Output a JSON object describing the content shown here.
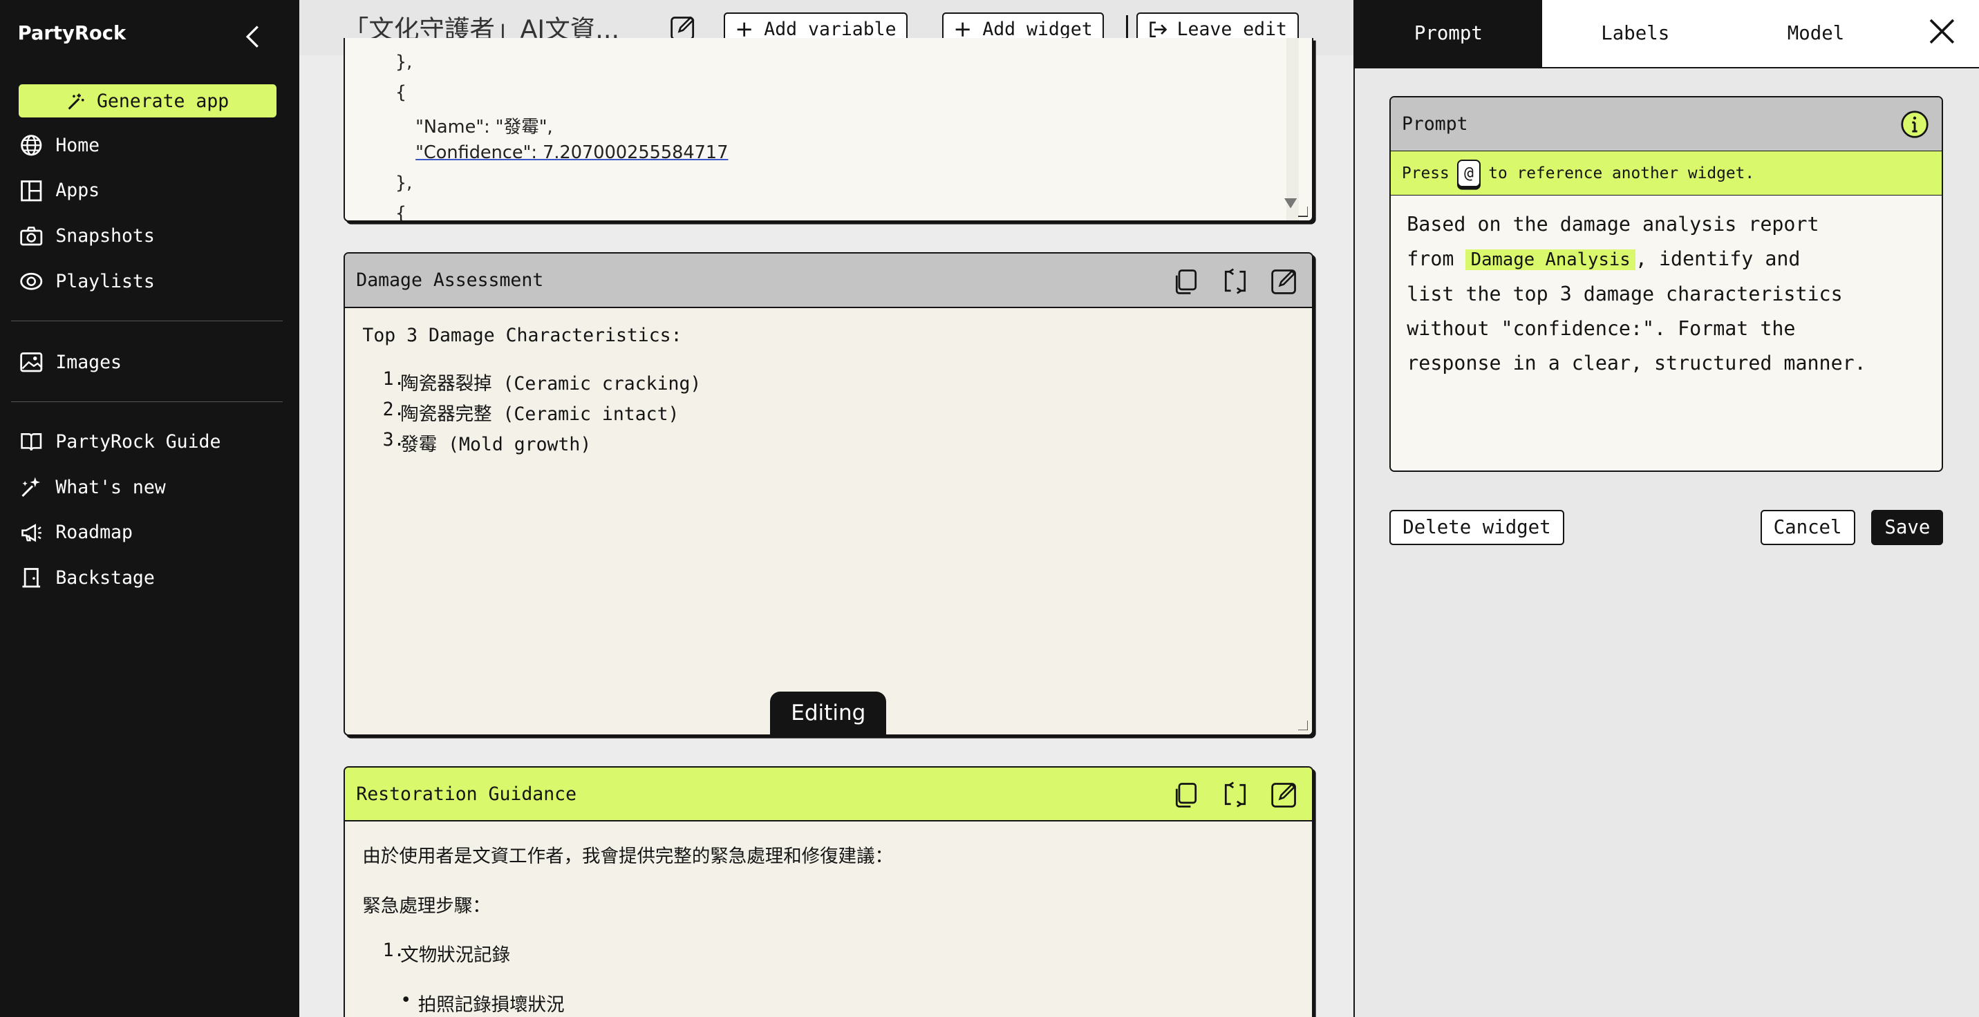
{
  "sidebar": {
    "brand": "PartyRock",
    "generate_label": "Generate app",
    "items": [
      {
        "label": "Home",
        "icon": "globe-icon"
      },
      {
        "label": "Apps",
        "icon": "apps-grid-icon"
      },
      {
        "label": "Snapshots",
        "icon": "camera-icon"
      },
      {
        "label": "Playlists",
        "icon": "playlist-icon"
      },
      {
        "label": "Images",
        "icon": "images-icon"
      },
      {
        "label": "PartyRock Guide",
        "icon": "book-icon"
      },
      {
        "label": "What's new",
        "icon": "sparkles-icon"
      },
      {
        "label": "Roadmap",
        "icon": "megaphone-icon"
      },
      {
        "label": "Backstage",
        "icon": "door-icon"
      }
    ]
  },
  "toolbar": {
    "app_title": "「文化守護者」AI文資...",
    "add_variable": "Add variable",
    "add_widget": "Add widget",
    "leave_edit": "Leave edit"
  },
  "damage_analysis": {
    "lines": [
      "},",
      "{",
      "\"Name\": \"發霉\",",
      "\"Confidence\": 7.207000255584717",
      "},",
      "{"
    ]
  },
  "damage_assessment": {
    "title": "Damage Assessment",
    "intro": "Top 3 Damage Characteristics:",
    "items": [
      {
        "num": "1.",
        "text": "陶瓷器裂掉 (Ceramic cracking)"
      },
      {
        "num": "2.",
        "text": "陶瓷器完整 (Ceramic intact)"
      },
      {
        "num": "3.",
        "text": "發霉 (Mold growth)"
      }
    ],
    "badge": "Editing"
  },
  "restoration": {
    "title": "Restoration Guidance",
    "para1": "由於使用者是文資工作者，我會提供完整的緊急處理和修復建議：",
    "para2": "緊急處理步驟：",
    "step1": "文物狀況記錄",
    "bullet1": "拍照記錄損壞狀況"
  },
  "panel": {
    "tabs": [
      "Prompt",
      "Labels",
      "Model"
    ],
    "prompt_header": "Prompt",
    "hint_before": "Press",
    "hint_key": "@",
    "hint_after": "to reference another widget.",
    "prompt_line1": "Based on the damage analysis report",
    "prompt_from": "from",
    "prompt_mention": "Damage Analysis",
    "prompt_after_mention": ", identify and",
    "prompt_line3": "list the top 3 damage characteristics",
    "prompt_line4": "without \"confidence:\". Format the",
    "prompt_line5": "response in a clear, structured manner.",
    "delete_label": "Delete widget",
    "cancel_label": "Cancel",
    "save_label": "Save"
  },
  "colors": {
    "accent": "#d9f86b",
    "dark": "#141414",
    "panel": "#f4f2e8"
  }
}
